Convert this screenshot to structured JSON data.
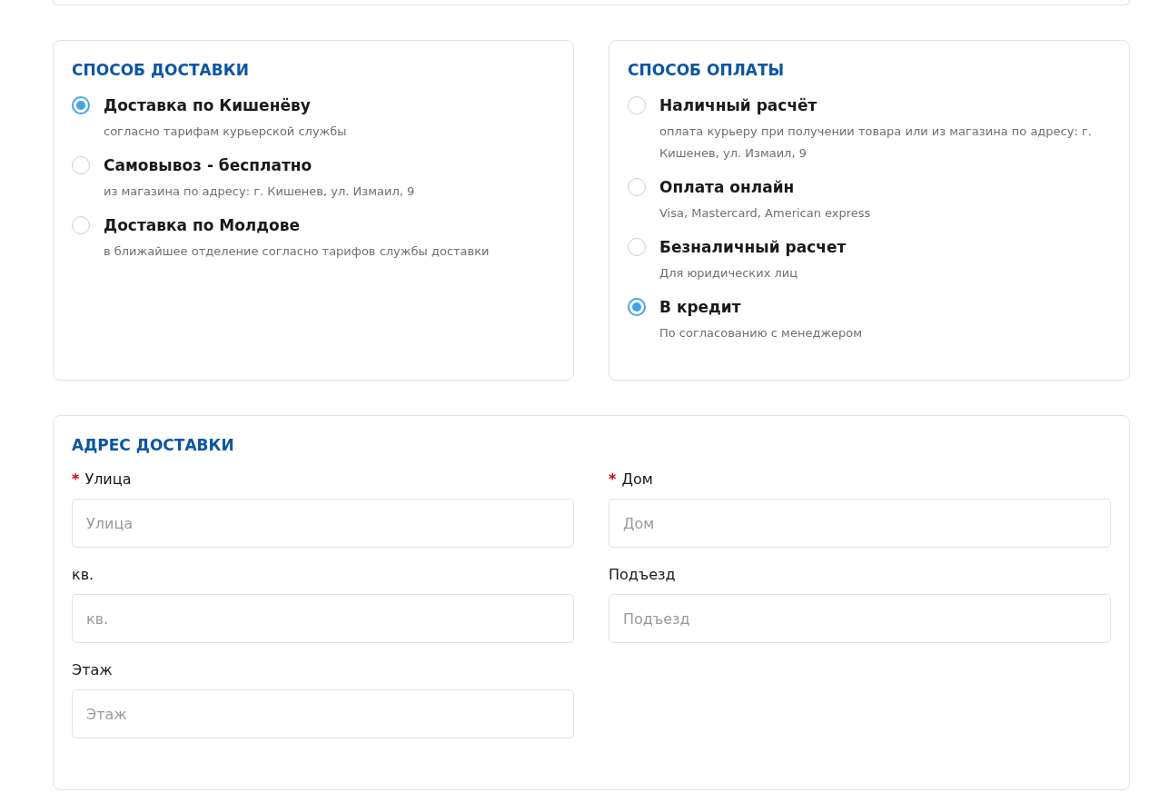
{
  "delivery": {
    "title": "СПОСОБ ДОСТАВКИ",
    "options": [
      {
        "label": "Доставка по Кишенёву",
        "description": "согласно тарифам курьерской службы",
        "selected": true
      },
      {
        "label": "Самовывоз - бесплатно",
        "description": "из магазина по адресу: г. Кишенев, ул. Измаил, 9",
        "selected": false
      },
      {
        "label": "Доставка по Молдове",
        "description": "в ближайшее отделение согласно тарифов службы доставки",
        "selected": false
      }
    ]
  },
  "payment": {
    "title": "СПОСОБ ОПЛАТЫ",
    "options": [
      {
        "label": "Наличный расчёт",
        "description": "оплата курьеру при получении товара или из магазина по адресу: г. Кишенев, ул. Измаил, 9",
        "selected": false
      },
      {
        "label": "Оплата онлайн",
        "description": "Visa, Mastercard, American express",
        "selected": false
      },
      {
        "label": "Безналичный расчет",
        "description": "Для юридических лиц",
        "selected": false
      },
      {
        "label": "В кредит",
        "description": "По согласованию с менеджером",
        "selected": true
      }
    ]
  },
  "address": {
    "title": "АДРЕС ДОСТАВКИ",
    "fields": [
      {
        "label": "Улица",
        "required_mark": "*",
        "placeholder": "Улица"
      },
      {
        "label": "Дом",
        "required_mark": "*",
        "placeholder": "Дом"
      },
      {
        "label": "кв.",
        "placeholder": "кв."
      },
      {
        "label": "Подъезд",
        "placeholder": "Подъезд"
      },
      {
        "label": "Этаж",
        "placeholder": "Этаж"
      }
    ]
  }
}
